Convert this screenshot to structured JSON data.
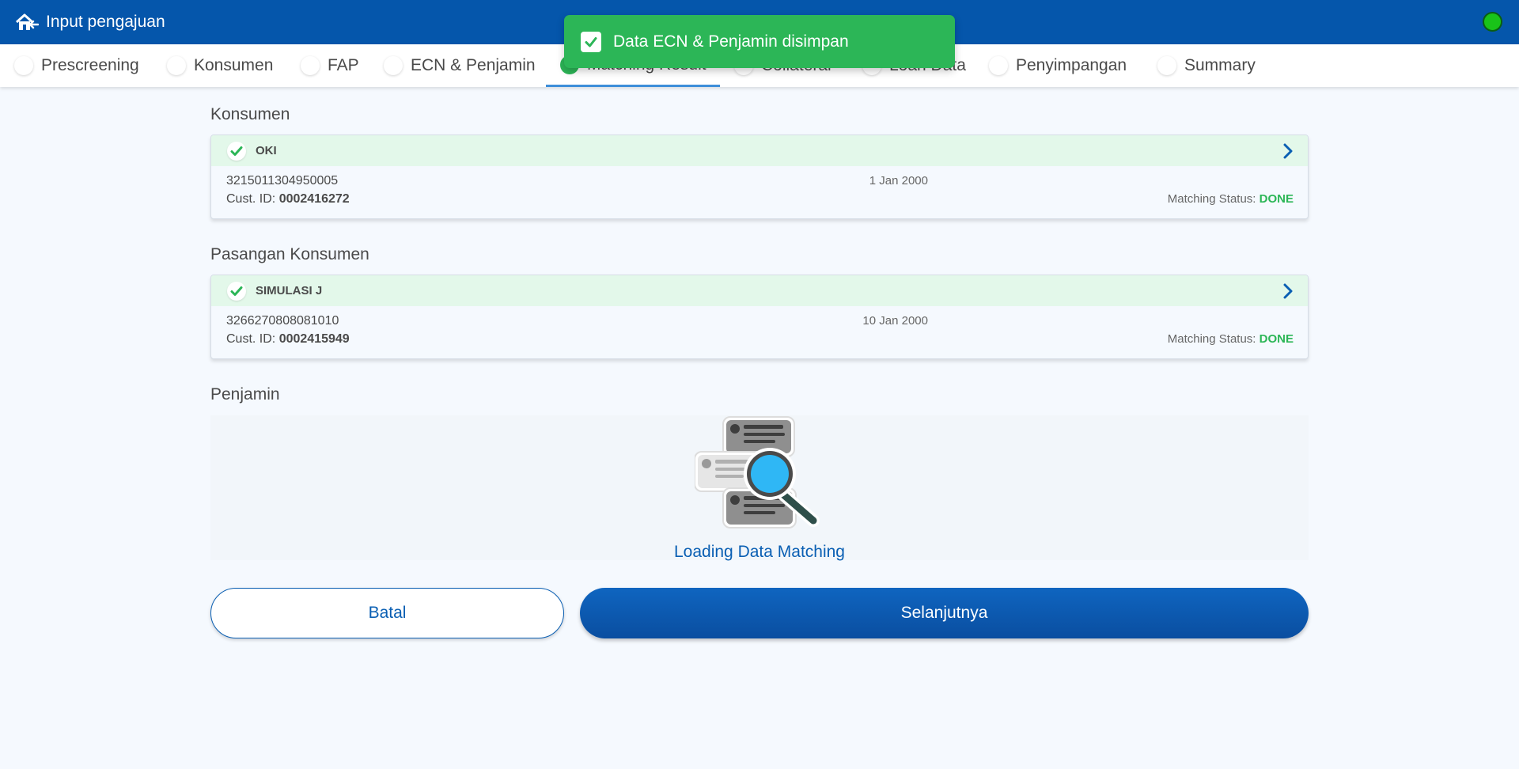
{
  "header": {
    "title": "Input pengajuan",
    "back_icon": "home-back-icon",
    "status_color": "#19c319"
  },
  "toast": {
    "message": "Data ECN & Penjamin disimpan",
    "color": "#2cb657"
  },
  "tabs": [
    {
      "label": "Prescreening"
    },
    {
      "label": "Konsumen"
    },
    {
      "label": "FAP"
    },
    {
      "label": "ECN & Penjamin"
    },
    {
      "label": "Matching Result",
      "active": true
    },
    {
      "label": "Collateral"
    },
    {
      "label": "Loan Data"
    },
    {
      "label": "Penyimpangan"
    },
    {
      "label": "Summary"
    }
  ],
  "sections": {
    "konsumen": {
      "title": "Konsumen",
      "name": "OKI",
      "nik": "3215011304950005",
      "cust_id_label": "Cust. ID:",
      "cust_id": "0002416272",
      "dob": "1 Jan 2000",
      "matching_label": "Matching Status:",
      "matching_status": "DONE"
    },
    "pasangan": {
      "title": "Pasangan Konsumen",
      "name": "SIMULASI J",
      "nik": "3266270808081010",
      "cust_id_label": "Cust. ID:",
      "cust_id": "0002415949",
      "dob": "10 Jan 2000",
      "matching_label": "Matching Status:",
      "matching_status": "DONE"
    },
    "penjamin": {
      "title": "Penjamin",
      "loading_text": "Loading Data Matching"
    }
  },
  "buttons": {
    "cancel": "Batal",
    "next": "Selanjutnya"
  },
  "colors": {
    "primary": "#0556ab",
    "success": "#2cb657"
  }
}
